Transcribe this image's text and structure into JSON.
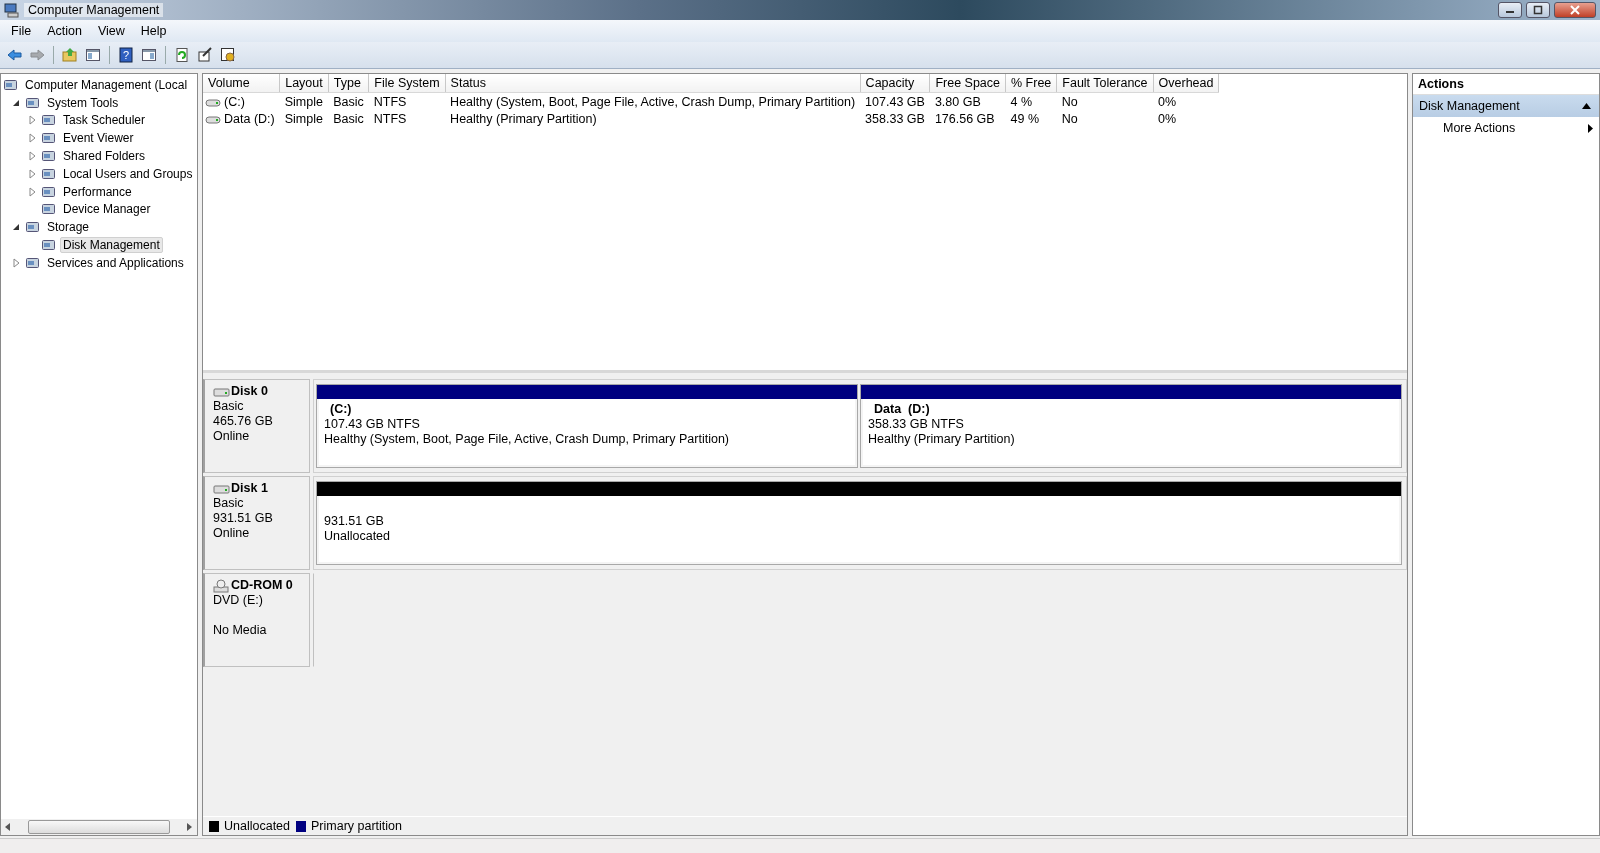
{
  "window": {
    "title": "Computer Management"
  },
  "menu": [
    "File",
    "Action",
    "View",
    "Help"
  ],
  "toolbar": [
    {
      "kind": "back",
      "disabled": false
    },
    {
      "kind": "forward",
      "disabled": true
    },
    {
      "kind": "up",
      "disabled": false
    },
    {
      "kind": "tree-pane",
      "disabled": false
    },
    {
      "kind": "help",
      "label": "?",
      "disabled": false
    },
    {
      "kind": "action-pane",
      "disabled": false
    },
    {
      "kind": "refresh",
      "disabled": false
    },
    {
      "kind": "properties",
      "disabled": false
    },
    {
      "kind": "settings",
      "disabled": false
    }
  ],
  "tree": [
    {
      "label": "Computer Management (Local",
      "selected": false,
      "children": [
        {
          "label": "System Tools",
          "selected": false,
          "expanded": true,
          "children": [
            {
              "label": "Task Scheduler",
              "selected": false,
              "expanded": false
            },
            {
              "label": "Event Viewer",
              "selected": false,
              "expanded": false
            },
            {
              "label": "Shared Folders",
              "selected": false,
              "expanded": false
            },
            {
              "label": "Local Users and Groups",
              "selected": false,
              "expanded": false
            },
            {
              "label": "Performance",
              "selected": false,
              "expanded": false
            },
            {
              "label": "Device Manager",
              "selected": false
            }
          ]
        },
        {
          "label": "Storage",
          "selected": false,
          "expanded": true,
          "children": [
            {
              "label": "Disk Management",
              "selected": true
            }
          ]
        },
        {
          "label": "Services and Applications",
          "selected": false,
          "expanded": false
        }
      ]
    }
  ],
  "table": {
    "columns": [
      "Volume",
      "Layout",
      "Type",
      "File System",
      "Status",
      "Capacity",
      "Free Space",
      "% Free",
      "Fault Tolerance",
      "Overhead"
    ],
    "rows": [
      [
        "(C:)",
        "Simple",
        "Basic",
        "NTFS",
        "Healthy (System, Boot, Page File, Active, Crash Dump, Primary Partition)",
        "107.43 GB",
        "3.80 GB",
        "4 %",
        "No",
        "0%"
      ],
      [
        "Data (D:)",
        "Simple",
        "Basic",
        "NTFS",
        "Healthy (Primary Partition)",
        "358.33 GB",
        "176.56 GB",
        "49 %",
        "No",
        "0%"
      ]
    ]
  },
  "disks": [
    {
      "kind": "disk",
      "name": "Disk 0",
      "type": "Basic",
      "size": "465.76 GB",
      "status": "Online",
      "partitions": [
        {
          "kind": "primary",
          "label": "(C:)",
          "size": "107.43 GB NTFS",
          "status": "Healthy (System, Boot, Page File, Active, Crash Dump, Primary Partition)"
        },
        {
          "kind": "primary",
          "label": "Data  (D:)",
          "size": "358.33 GB NTFS",
          "status": "Healthy (Primary Partition)"
        }
      ]
    },
    {
      "kind": "disk",
      "name": "Disk 1",
      "type": "Basic",
      "size": "931.51 GB",
      "status": "Online",
      "partitions": [
        {
          "kind": "unallocated",
          "size": "931.51 GB",
          "status": "Unallocated"
        }
      ]
    },
    {
      "kind": "cdrom",
      "name": "CD-ROM 0",
      "type": "DVD (E:)",
      "status": "No Media"
    }
  ],
  "legend": [
    {
      "label": "Unallocated",
      "color": "#000000"
    },
    {
      "label": "Primary partition",
      "color": "#000080"
    }
  ],
  "actions": {
    "title": "Actions",
    "sections": [
      {
        "title": "Disk Management",
        "expanded": true,
        "items": [
          "More Actions"
        ]
      }
    ]
  }
}
